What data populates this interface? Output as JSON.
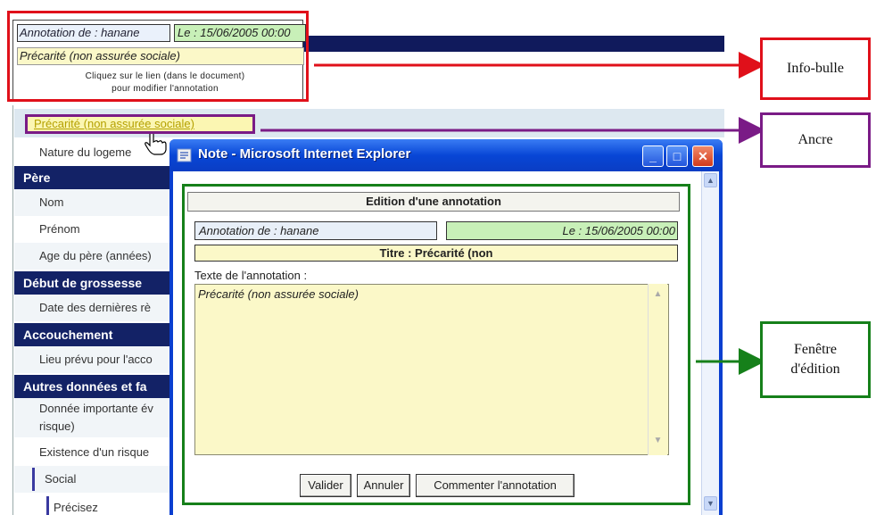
{
  "tooltip": {
    "author": "Annotation de : hanane",
    "date": "Le : 15/06/2005 00:00",
    "title": "Précarité (non assurée sociale)",
    "hint_line1": "Cliquez sur le lien (dans le document)",
    "hint_line2": "pour modifier l'annotation"
  },
  "form": {
    "anchor_link": "Précarité (non assurée sociale)",
    "rows": {
      "nature_logement": "Nature du logeme",
      "pere_header": "Père",
      "nom": "Nom",
      "prenom": "Prénom",
      "age_pere": "Age du père (années)",
      "debut_header": "Début de grossesse",
      "date_dernieres": "Date des dernières rè",
      "accouchement_header": "Accouchement",
      "lieu_prevu": "Lieu prévu pour l'acco",
      "autres_header": "Autres données et fa",
      "donnee_importante_1": "Donnée importante év",
      "donnee_importante_2": "risque)",
      "existence_risque": "Existence d'un risque",
      "social": "Social",
      "precisez": "Précisez"
    }
  },
  "window": {
    "title": "Note - Microsoft Internet Explorer",
    "minimize": "_",
    "maximize": "□",
    "close": "✕"
  },
  "editor": {
    "heading": "Edition d'une annotation",
    "author": "Annotation de : hanane",
    "date": "Le : 15/06/2005 00:00",
    "subject": "Titre : Précarité (non",
    "text_label": "Texte de l'annotation :",
    "text_value": "Précarité (non assurée sociale)",
    "buttons": {
      "validate": "Valider",
      "cancel": "Annuler",
      "comment": "Commenter l'annotation"
    }
  },
  "callouts": {
    "infobulle": "Info-bulle",
    "ancre": "Ancre",
    "fenetre_line1": "Fenêtre",
    "fenetre_line2": "d'édition"
  },
  "colors": {
    "tooltip_frame": "#e0101a",
    "anchor_frame": "#7a1b86",
    "editor_frame": "#16801a",
    "header_bg": "#132266",
    "window_blue": "#0a3fd0"
  },
  "icons": [
    "ie-icon",
    "hand-cursor-icon",
    "scroll-up-icon",
    "scroll-down-icon"
  ]
}
